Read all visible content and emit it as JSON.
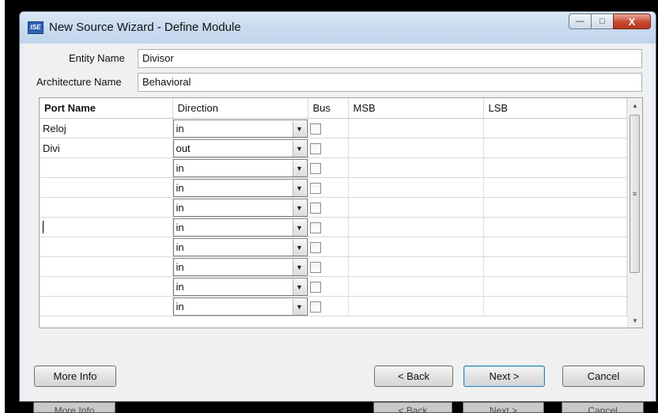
{
  "window": {
    "title": "New Source Wizard - Define Module",
    "app_icon": "ise-app-icon"
  },
  "form": {
    "entity_label": "Entity Name",
    "entity_value": "Divisor",
    "arch_label": "Architecture Name",
    "arch_value": "Behavioral"
  },
  "table": {
    "headers": [
      "Port Name",
      "Direction",
      "Bus",
      "MSB",
      "LSB"
    ],
    "rows": [
      {
        "name": "Reloj",
        "direction": "in"
      },
      {
        "name": "Divi",
        "direction": "out"
      },
      {
        "name": "",
        "direction": "in"
      },
      {
        "name": "",
        "direction": "in"
      },
      {
        "name": "",
        "direction": "in"
      },
      {
        "name": "",
        "direction": "in"
      },
      {
        "name": "",
        "direction": "in"
      },
      {
        "name": "",
        "direction": "in"
      },
      {
        "name": "",
        "direction": "in"
      },
      {
        "name": "",
        "direction": "in"
      }
    ]
  },
  "buttons": {
    "more_info": "More Info",
    "back": "< Back",
    "next": "Next >",
    "cancel": "Cancel"
  },
  "ghost_buttons": {
    "more_info": "More Info",
    "back": "< Back",
    "next": "Next >",
    "cancel": "Cancel"
  },
  "colors": {
    "title_bg": "#cadcf0",
    "close_btn": "#c74a32",
    "default_btn": "#3c7fb1"
  }
}
